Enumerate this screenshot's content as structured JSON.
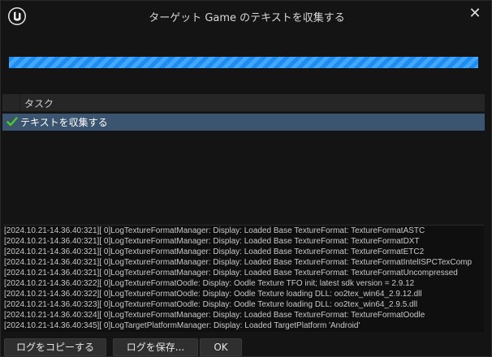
{
  "window": {
    "title": "ターゲット Game のテキストを収集する",
    "close_symbol": "✕",
    "logo_icon": "unreal-engine-logo-icon"
  },
  "progress": {
    "fraction": 1.0,
    "color": "#1f8cf0"
  },
  "tasks": {
    "header": "タスク",
    "items": [
      {
        "label": "テキストを収集する",
        "status_icon": "check-icon",
        "status_color": "#4ccc2a"
      }
    ]
  },
  "log": {
    "lines": [
      "[2024.10.21-14.36.40:321][  0]LogTextureFormatManager: Display: Loaded Base TextureFormat: TextureFormatASTC",
      "[2024.10.21-14.36.40:321][  0]LogTextureFormatManager: Display: Loaded Base TextureFormat: TextureFormatDXT",
      "[2024.10.21-14.36.40:321][  0]LogTextureFormatManager: Display: Loaded Base TextureFormat: TextureFormatETC2",
      "[2024.10.21-14.36.40:321][  0]LogTextureFormatManager: Display: Loaded Base TextureFormat: TextureFormatIntelISPCTexComp",
      "[2024.10.21-14.36.40:321][  0]LogTextureFormatManager: Display: Loaded Base TextureFormat: TextureFormatUncompressed",
      "[2024.10.21-14.36.40:322][  0]LogTextureFormatOodle: Display: Oodle Texture TFO init; latest sdk version = 2.9.12",
      "[2024.10.21-14.36.40:322][  0]LogTextureFormatOodle: Display: Oodle Texture loading DLL: oo2tex_win64_2.9.12.dll",
      "[2024.10.21-14.36.40:323][  0]LogTextureFormatOodle: Display: Oodle Texture loading DLL: oo2tex_win64_2.9.5.dll",
      "[2024.10.21-14.36.40:324][  0]LogTextureFormatManager: Display: Loaded Base TextureFormat: TextureFormatOodle",
      "[2024.10.21-14.36.40:345][  0]LogTargetPlatformManager: Display: Loaded TargetPlatform 'Android'"
    ]
  },
  "buttons": {
    "copy_log": "ログをコピーする",
    "save_log": "ログを保存...",
    "ok": "OK"
  }
}
